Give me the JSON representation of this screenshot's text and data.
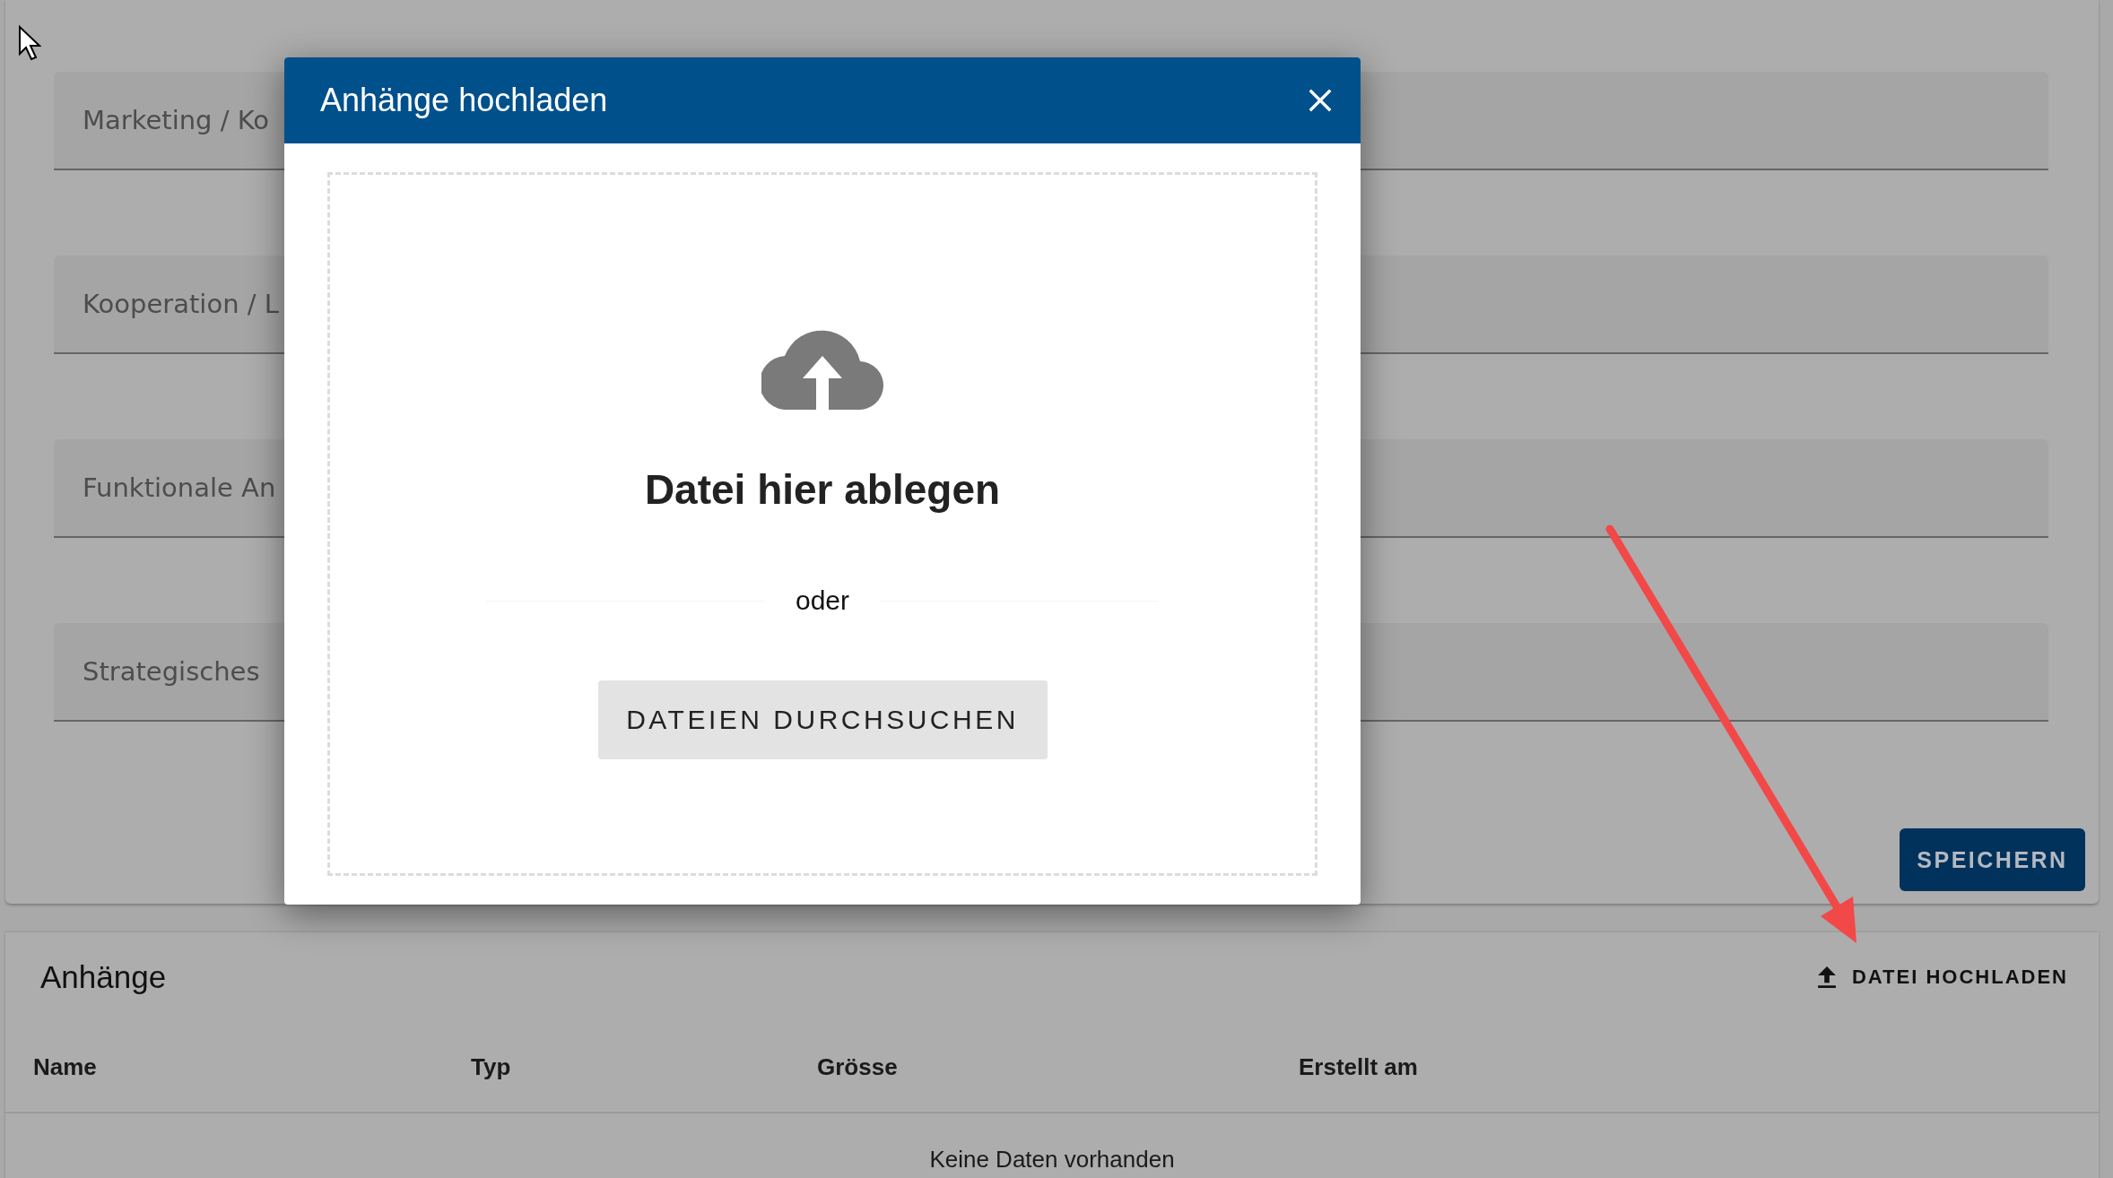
{
  "form": {
    "fields": [
      {
        "label": "Marketing / Ko"
      },
      {
        "label": "Kooperation / L"
      },
      {
        "label": "Funktionale An"
      },
      {
        "label": "Strategisches"
      }
    ],
    "save_button": "SPEICHERN"
  },
  "attachments": {
    "title": "Anhänge",
    "upload_button": "DATEI HOCHLADEN",
    "columns": [
      "Name",
      "Typ",
      "Grösse",
      "Erstellt am"
    ],
    "empty_message": "Keine Daten vorhanden"
  },
  "dialog": {
    "title": "Anhänge hochladen",
    "dropzone": {
      "heading": "Datei hier ablegen",
      "separator": "oder",
      "browse_button": "DATEIEN DURCHSUCHEN"
    }
  }
}
